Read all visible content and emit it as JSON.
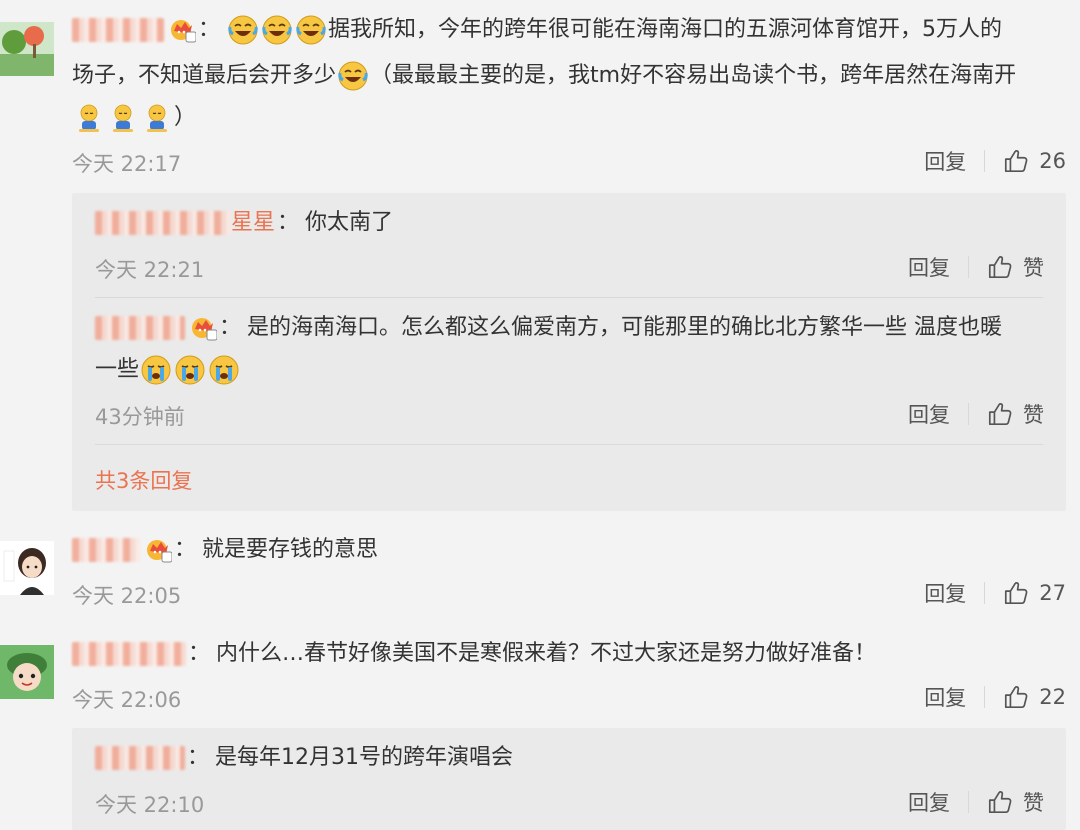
{
  "comments": [
    {
      "name_tail": "",
      "text_1": "据我所知，今年的跨年很可能在海南海口的五源河体育馆开，5万人的",
      "text_2": "场子，不知道最后会开多少",
      "text_3": "（最最最主要的是，我tm好不容易出岛读个书，跨年居然在海南开",
      "text_4": "）",
      "time": "今天 22:17",
      "reply_label": "回复",
      "likes": "26",
      "emoji": [
        "laugh-cry-emoji",
        "laugh-cry-emoji",
        "laugh-cry-emoji",
        "laugh-cry-emoji",
        "sad-kneel-emoji",
        "sad-kneel-emoji",
        "sad-kneel-emoji"
      ],
      "crown_level": "6",
      "replies": [
        {
          "name_tail": "星星",
          "text": "你太南了",
          "time": "今天 22:21",
          "reply_label": "回复",
          "like_label": "赞"
        },
        {
          "name_tail": "",
          "text_1": "是的海南海口。怎么都这么偏爱南方，可能那里的确比北方繁华一些 温度也暖",
          "text_2": "一些",
          "time": "43分钟前",
          "reply_label": "回复",
          "like_label": "赞",
          "crown_level": "3",
          "emoji": [
            "crying-emoji",
            "crying-emoji",
            "crying-emoji"
          ]
        }
      ],
      "more_replies": "共3条回复"
    },
    {
      "text": "就是要存钱的意思",
      "time": "今天 22:05",
      "reply_label": "回复",
      "likes": "27",
      "crown_level": "5"
    },
    {
      "text": "内什么…春节好像美国不是寒假来着？不过大家还是努力做好准备！",
      "time": "今天 22:06",
      "reply_label": "回复",
      "likes": "22",
      "replies": [
        {
          "text": "是每年12月31号的跨年演唱会",
          "time": "今天 22:10",
          "reply_label": "回复",
          "like_label": "赞"
        }
      ]
    }
  ],
  "colors": {
    "background": "#f3f3f3",
    "reply_box": "#eaeaea",
    "username_accent": "#eb7350",
    "meta_grey": "#999999"
  }
}
